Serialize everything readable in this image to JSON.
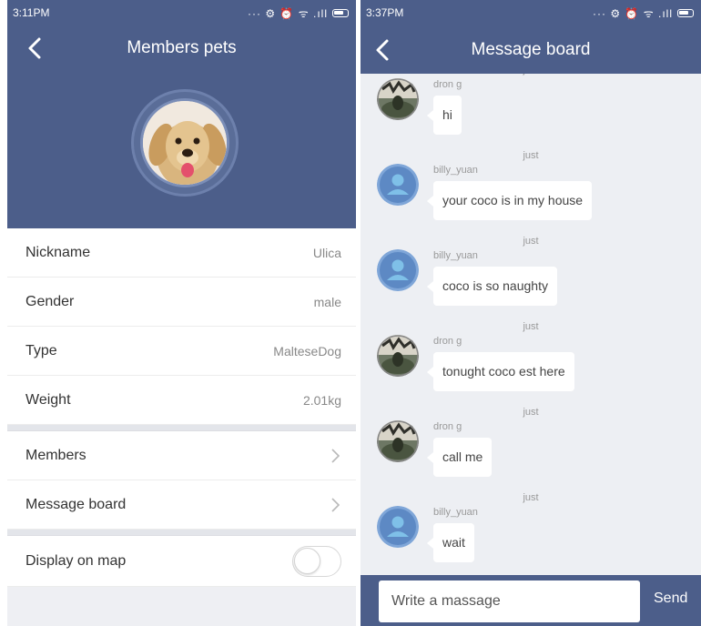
{
  "colors": {
    "header": "#4c5e8a",
    "background": "#edeff3",
    "bubble": "#ffffff",
    "muted": "#999999"
  },
  "left": {
    "status": {
      "time": "3:11PM",
      "icons": "··· ⚙ ⏰ ᯤ .ıll"
    },
    "title": "Members pets",
    "avatar_icon": "dog-photo",
    "details": [
      {
        "label": "Nickname",
        "value": "Ulica"
      },
      {
        "label": "Gender",
        "value": "male"
      },
      {
        "label": "Type",
        "value": "MalteseDog"
      },
      {
        "label": "Weight",
        "value": "2.01kg"
      }
    ],
    "links": [
      {
        "label": "Members"
      },
      {
        "label": "Message board"
      }
    ],
    "map_toggle": {
      "label": "Display on map",
      "on": false
    }
  },
  "right": {
    "status": {
      "time": "3:37PM",
      "icons": "··· ⚙ ⏰ ᯤ .ıll"
    },
    "title": "Message board",
    "messages": [
      {
        "time": "just",
        "name": "dron g",
        "text": "hi",
        "avatar": "photo-avatar"
      },
      {
        "time": "just",
        "name": "billy_yuan",
        "text": "your coco is in my house",
        "avatar": "default-user-avatar"
      },
      {
        "time": "just",
        "name": "billy_yuan",
        "text": "coco is so naughty",
        "avatar": "default-user-avatar"
      },
      {
        "time": "just",
        "name": "dron g",
        "text": "tonught coco est here",
        "avatar": "photo-avatar"
      },
      {
        "time": "just",
        "name": "dron g",
        "text": "call me",
        "avatar": "photo-avatar"
      },
      {
        "time": "just",
        "name": "billy_yuan",
        "text": "wait",
        "avatar": "default-user-avatar"
      }
    ],
    "compose": {
      "placeholder": "Write a massage",
      "send_label": "Send"
    }
  }
}
